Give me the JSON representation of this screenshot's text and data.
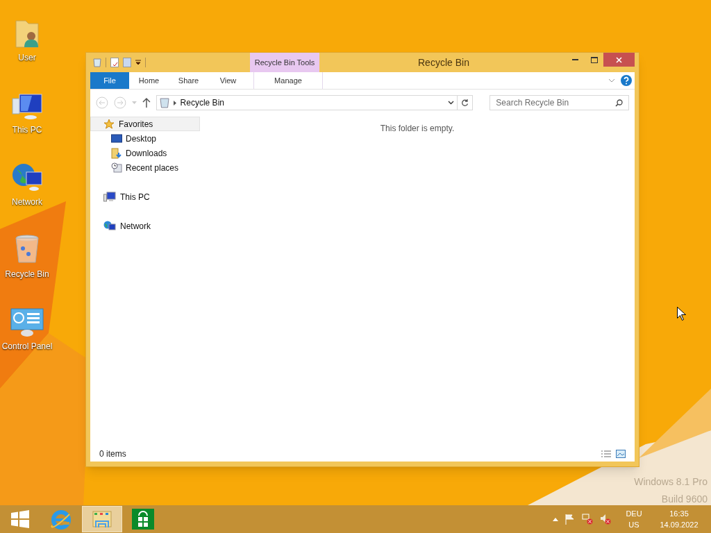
{
  "desktop_icons": [
    {
      "kind": "user",
      "label": "User"
    },
    {
      "kind": "pc",
      "label": "This PC"
    },
    {
      "kind": "network",
      "label": "Network"
    },
    {
      "kind": "recycle",
      "label": "Recycle Bin"
    },
    {
      "kind": "control",
      "label": "Control Panel"
    }
  ],
  "window": {
    "title": "Recycle Bin",
    "context_group": "Recycle Bin Tools",
    "tabs": [
      {
        "kind": "file",
        "label": "File",
        "selected": false
      },
      {
        "kind": "tab",
        "label": "Home",
        "selected": false
      },
      {
        "kind": "tab",
        "label": "Share",
        "selected": false
      },
      {
        "kind": "tab",
        "label": "View",
        "selected": false
      },
      {
        "kind": "context",
        "label": "Manage",
        "selected": false
      }
    ],
    "address": {
      "path": "Recycle Bin"
    },
    "search": {
      "placeholder": "Search Recycle Bin"
    },
    "navigation": [
      {
        "kind": "favorites",
        "label": "Favorites",
        "selected": true,
        "children": [
          {
            "kind": "desktop",
            "label": "Desktop",
            "selected": false
          },
          {
            "kind": "downloads",
            "label": "Downloads",
            "selected": false
          },
          {
            "kind": "recent",
            "label": "Recent places",
            "selected": false
          }
        ]
      },
      {
        "kind": "pc",
        "label": "This PC",
        "selected": false
      },
      {
        "kind": "network",
        "label": "Network",
        "selected": false
      }
    ],
    "empty_message": "This folder is empty.",
    "status_bar": {
      "item_count": "0 items"
    }
  },
  "watermark": {
    "edition": "Windows 8.1 Pro",
    "build": "Build 9600"
  },
  "taskbar": {
    "apps": [
      {
        "kind": "start",
        "selected": false
      },
      {
        "kind": "browser",
        "selected": false
      },
      {
        "kind": "explorer",
        "selected": true
      },
      {
        "kind": "store",
        "selected": false
      }
    ],
    "tray": {
      "language": "DEU",
      "layout": "US",
      "time": "16:35",
      "date": "14.09.2022"
    }
  }
}
